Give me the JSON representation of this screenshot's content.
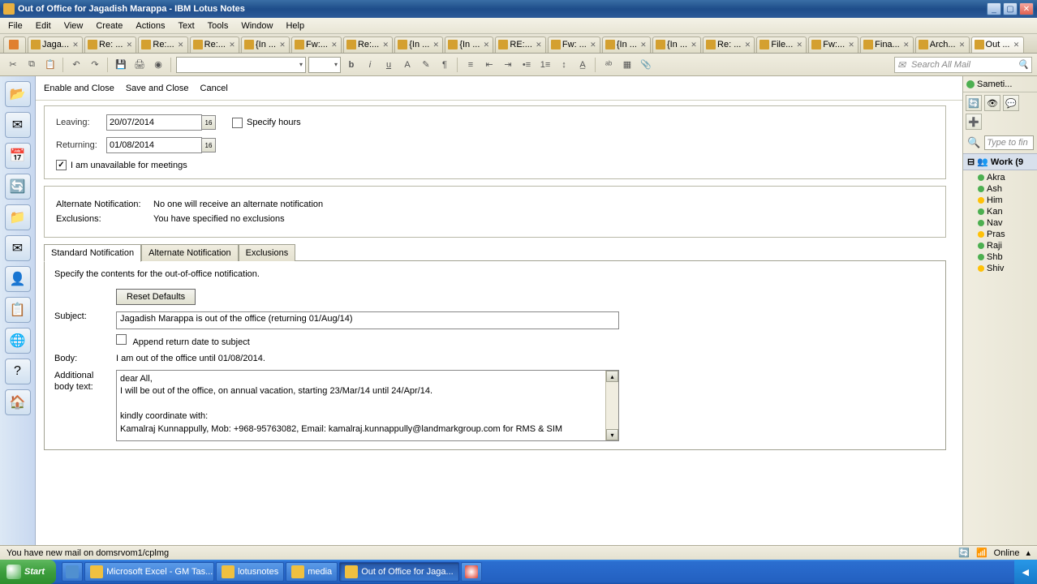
{
  "titlebar": {
    "title": "Out of Office for Jagadish Marappa - IBM Lotus Notes"
  },
  "menubar": [
    "File",
    "Edit",
    "View",
    "Create",
    "Actions",
    "Text",
    "Tools",
    "Window",
    "Help"
  ],
  "doctabs": [
    {
      "label": "Jaga...",
      "icon": "home"
    },
    {
      "label": "Re: ..."
    },
    {
      "label": "Re:..."
    },
    {
      "label": "Re:..."
    },
    {
      "label": "{In ..."
    },
    {
      "label": "Fw:..."
    },
    {
      "label": "Re:..."
    },
    {
      "label": "{In ..."
    },
    {
      "label": "{In ..."
    },
    {
      "label": "RE:..."
    },
    {
      "label": "Fw: ..."
    },
    {
      "label": "{In ..."
    },
    {
      "label": "{In ..."
    },
    {
      "label": "Re: ..."
    },
    {
      "label": "File..."
    },
    {
      "label": "Fw:..."
    },
    {
      "label": "Fina..."
    },
    {
      "label": "Arch..."
    },
    {
      "label": "Out ...",
      "active": true
    }
  ],
  "toolbar": {
    "search_placeholder": "Search All Mail"
  },
  "actionbar": {
    "enable": "Enable and Close",
    "save": "Save and Close",
    "cancel": "Cancel"
  },
  "dates": {
    "leaving_label": "Leaving:",
    "leaving": "20/07/2014",
    "returning_label": "Returning:",
    "returning": "01/08/2014",
    "specify_hours": "Specify hours",
    "unavailable": "I am unavailable for meetings"
  },
  "alt": {
    "label": "Alternate Notification:",
    "value": "No one will receive an alternate notification",
    "excl_label": "Exclusions:",
    "excl_value": "You have specified no exclusions"
  },
  "tabs": {
    "std": "Standard Notification",
    "alt": "Alternate Notification",
    "excl": "Exclusions"
  },
  "form": {
    "instr": "Specify the contents for the out-of-office notification.",
    "reset": "Reset Defaults",
    "subject_label": "Subject:",
    "subject": "Jagadish Marappa is out of the office (returning 01/Aug/14)",
    "append": "Append return date to subject",
    "body_label": "Body:",
    "body": "I am out of the office until 01/08/2014.",
    "addl_label": "Additional body text:",
    "addl": "dear All,\nI will be out of the office, on annual vacation, starting 23/Mar/14 until 24/Apr/14.\n\nkindly coordinate with:\nKamalraj Kunnappully, Mob: +968-95763082, Email: kamalraj.kunnappully@landmarkgroup.com for RMS & SIM"
  },
  "side": {
    "sametime": "Sameti...",
    "search_ph": "Type to fin",
    "work_hdr": "Work (9",
    "contacts": [
      "Akra",
      "Ash",
      "Him",
      "Kan",
      "Nav",
      "Pras",
      "Raji",
      "Shb",
      "Shiv"
    ]
  },
  "status": {
    "msg": "You have new mail on domsrvom1/cplmg",
    "online": "Online"
  },
  "taskbar": {
    "start": "Start",
    "tasks": [
      {
        "label": "Microsoft Excel - GM Tas..."
      },
      {
        "label": "lotusnotes"
      },
      {
        "label": "media"
      },
      {
        "label": "Out of Office for Jaga...",
        "active": true
      }
    ]
  }
}
